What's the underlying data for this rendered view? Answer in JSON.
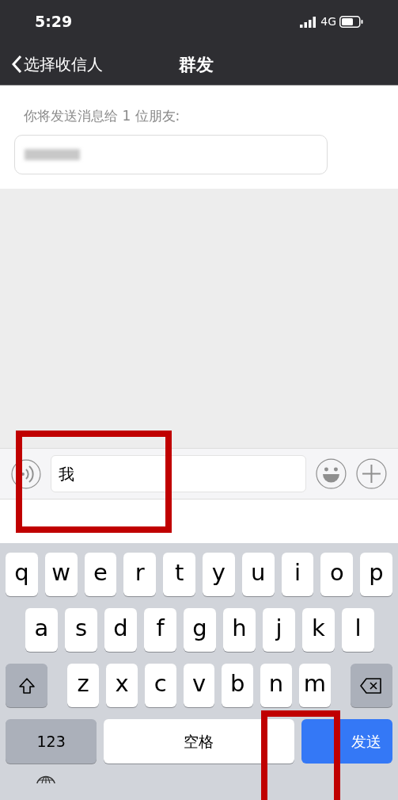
{
  "status_bar": {
    "time": "5:29",
    "network": "4G"
  },
  "nav_bar": {
    "back_label": "选择收信人",
    "title": "群发"
  },
  "recipients": {
    "label": "你将发送消息给 1 位朋友:"
  },
  "input_bar": {
    "value": "我"
  },
  "keyboard": {
    "rows": [
      [
        "q",
        "w",
        "e",
        "r",
        "t",
        "y",
        "u",
        "i",
        "o",
        "p"
      ],
      [
        "a",
        "s",
        "d",
        "f",
        "g",
        "h",
        "j",
        "k",
        "l"
      ],
      [
        "z",
        "x",
        "c",
        "v",
        "b",
        "n",
        "m"
      ]
    ],
    "numbers_key": "123",
    "space_key": "空格",
    "send_key": "发送"
  }
}
